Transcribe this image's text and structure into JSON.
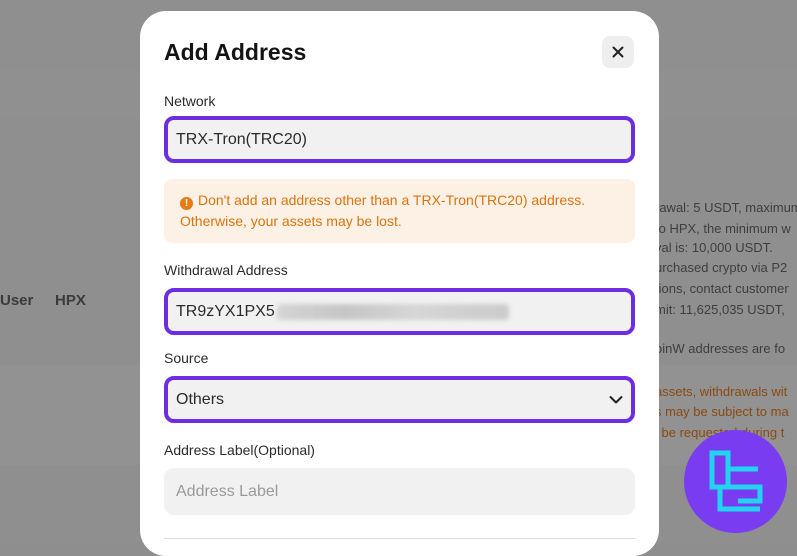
{
  "background": {
    "nav": [
      "User",
      "HPX"
    ],
    "lines": [
      "rawal: 5 USDT, maximum",
      "to HPX, the minimum w",
      "val is: 10,000 USDT.",
      "urchased crypto via P2",
      "tions, contact customer",
      "mit: 11,625,035 USDT,",
      "oinW addresses are fo",
      "assets, withdrawals wit",
      "s may be subject to ma",
      "l be requested during t"
    ]
  },
  "modal": {
    "title": "Add Address",
    "network": {
      "label": "Network",
      "value": "TRX-Tron(TRC20)"
    },
    "warning": "Don't add an address other than a TRX-Tron(TRC20) address. Otherwise, your assets may be lost.",
    "address": {
      "label": "Withdrawal Address",
      "value": "TR9zYX1PX5"
    },
    "source": {
      "label": "Source",
      "value": "Others"
    },
    "address_label": {
      "label": "Address Label(Optional)",
      "placeholder": "Address Label"
    }
  },
  "colors": {
    "accent": "#6c2ee0",
    "warning_text": "#d9730d",
    "warning_bg": "#fdf1e6"
  },
  "icons": {
    "close": "close-icon",
    "warning": "warning-icon",
    "dropdown": "chevron-down-icon",
    "watermark": "logo-icon"
  }
}
